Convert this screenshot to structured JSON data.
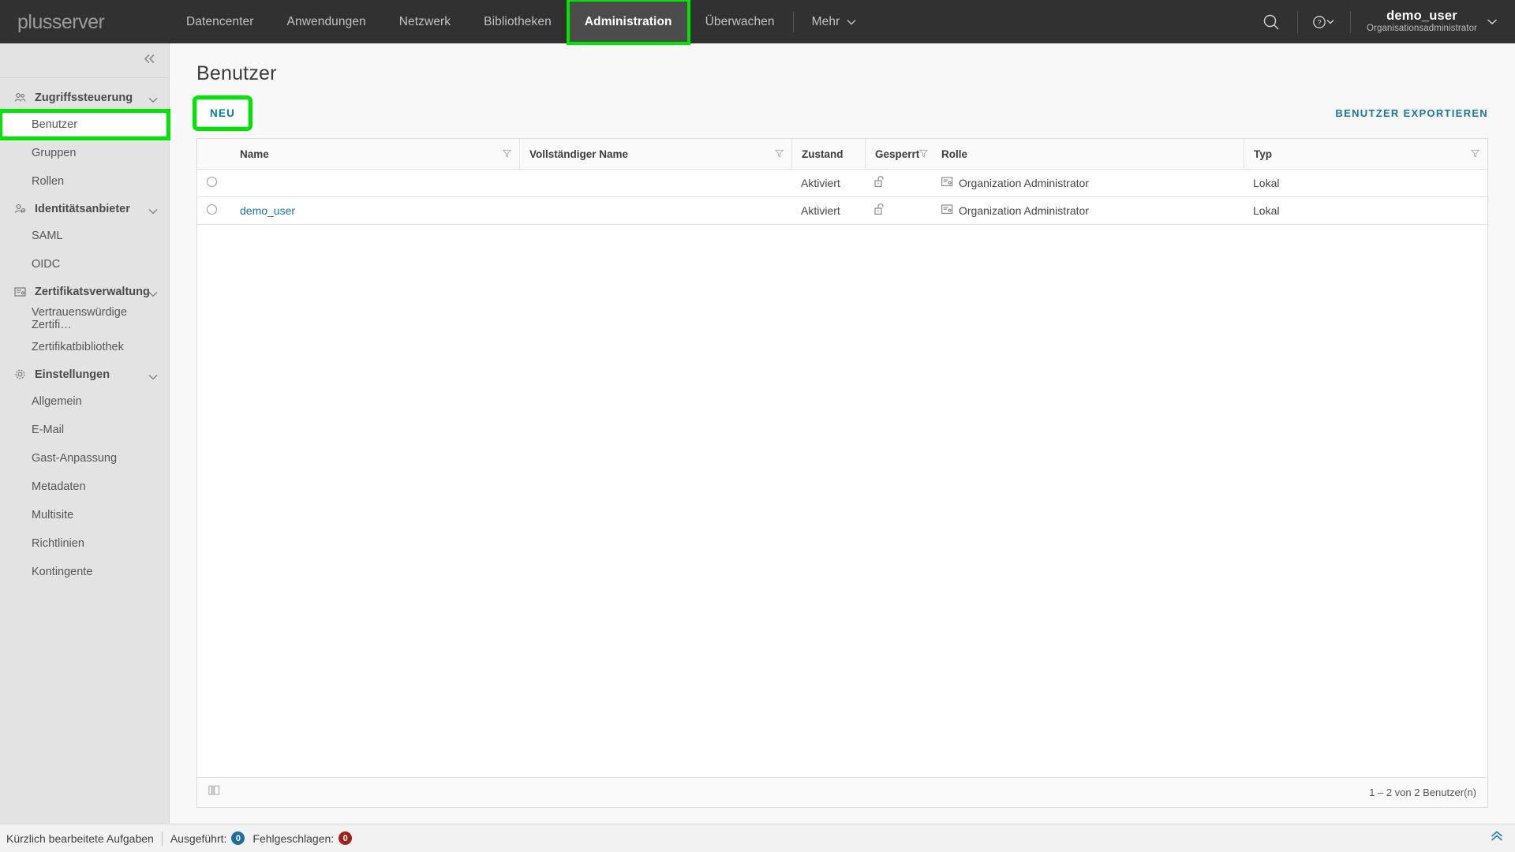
{
  "brand": {
    "name": "plusserver"
  },
  "topnav": {
    "items": [
      {
        "label": "Datencenter",
        "active": false
      },
      {
        "label": "Anwendungen",
        "active": false
      },
      {
        "label": "Netzwerk",
        "active": false
      },
      {
        "label": "Bibliotheken",
        "active": false
      },
      {
        "label": "Administration",
        "active": true,
        "highlight": true
      },
      {
        "label": "Überwachen",
        "active": false
      }
    ],
    "more_label": "Mehr",
    "search_icon": "search-icon",
    "help_icon": "help-circle-icon",
    "user": {
      "name": "demo_user",
      "role": "Organisationsadministrator"
    }
  },
  "sidebar": {
    "collapse_icon": "chevron-double-left-icon",
    "groups": [
      {
        "label": "Zugriffssteuerung",
        "icon": "users-group-icon",
        "expanded": true,
        "links": [
          {
            "label": "Benutzer",
            "selected": true,
            "highlight": true
          },
          {
            "label": "Gruppen",
            "selected": false
          },
          {
            "label": "Rollen",
            "selected": false
          }
        ]
      },
      {
        "label": "Identitätsanbieter",
        "icon": "user-settings-icon",
        "expanded": true,
        "links": [
          {
            "label": "SAML",
            "selected": false
          },
          {
            "label": "OIDC",
            "selected": false
          }
        ]
      },
      {
        "label": "Zertifikatsverwaltung",
        "icon": "certificate-icon",
        "expanded": true,
        "links": [
          {
            "label": "Vertrauenswürdige Zertifi…",
            "selected": false
          },
          {
            "label": "Zertifikatbibliothek",
            "selected": false
          }
        ]
      },
      {
        "label": "Einstellungen",
        "icon": "gear-icon",
        "expanded": true,
        "links": [
          {
            "label": "Allgemein",
            "selected": false
          },
          {
            "label": "E-Mail",
            "selected": false
          },
          {
            "label": "Gast-Anpassung",
            "selected": false
          },
          {
            "label": "Metadaten",
            "selected": false
          },
          {
            "label": "Multisite",
            "selected": false
          },
          {
            "label": "Richtlinien",
            "selected": false
          },
          {
            "label": "Kontingente",
            "selected": false
          }
        ]
      }
    ]
  },
  "main": {
    "title": "Benutzer",
    "new_button": "NEU",
    "export_link": "BENUTZER EXPORTIEREN",
    "table": {
      "columns": [
        {
          "label": "",
          "key": "select",
          "filter": false
        },
        {
          "label": "Name",
          "key": "name",
          "filter": true
        },
        {
          "label": "Vollständiger Name",
          "key": "fullname",
          "filter": true
        },
        {
          "label": "Zustand",
          "key": "state",
          "filter": false
        },
        {
          "label": "Gesperrt",
          "key": "locked",
          "filter": true
        },
        {
          "label": "Rolle",
          "key": "role",
          "filter": false
        },
        {
          "label": "Typ",
          "key": "type",
          "filter": true
        }
      ],
      "rows": [
        {
          "name": "",
          "fullname": "",
          "state": "Aktiviert",
          "locked_icon": "unlocked-padlock-icon",
          "role": "Organization Administrator",
          "role_icon": "role-card-icon",
          "type": "Lokal"
        },
        {
          "name": "demo_user",
          "fullname": "",
          "state": "Aktiviert",
          "locked_icon": "unlocked-padlock-icon",
          "role": "Organization Administrator",
          "role_icon": "role-card-icon",
          "type": "Lokal"
        }
      ],
      "footer_columns_icon": "columns-toggle-icon",
      "footer_count": "1 – 2 von 2 Benutzer(n)"
    }
  },
  "statusbar": {
    "tasks_label": "Kürzlich bearbeitete Aufgaben",
    "running_label": "Ausgeführt:",
    "running_count": "0",
    "failed_label": "Fehlgeschlagen:",
    "failed_count": "0",
    "expand_icon": "chevron-double-up-icon"
  },
  "colors": {
    "nav_bg": "#313131",
    "nav_active_bg": "#4c4c4c",
    "highlight_green": "#00e500",
    "link_blue": "#1a74a4",
    "sidebar_bg": "#e3e3e3",
    "badge_ok": "#1c6e9c",
    "badge_fail": "#9e2217"
  }
}
